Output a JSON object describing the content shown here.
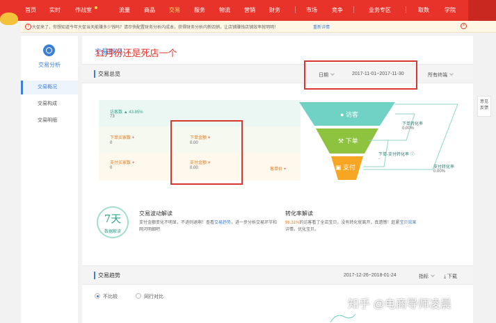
{
  "nav": {
    "items": [
      "首页",
      "实时",
      "作战室",
      "流量",
      "商品",
      "交易",
      "服务",
      "物流",
      "营销",
      "财务",
      "市场",
      "竞争",
      "业务专区",
      "取数",
      "学院"
    ]
  },
  "notice": {
    "text": "大促来了，你想知道今年大促当天能赚多少钱吗？请尽快配置财务分析内成本，获得财务分析内新四销，让店铺赚钱店铺效率就明明！",
    "link": "重新详情",
    "close": "×"
  },
  "sidebar": {
    "title": "交易分析",
    "items": [
      "交易概况",
      "交易构成",
      "交易明细"
    ]
  },
  "main": {
    "page_title": "交易概况",
    "overview": {
      "label": "交易总览",
      "date_label": "日期",
      "date_range": "2017-11-01~2017-11-30",
      "terminal": "所有终端"
    },
    "annotation": "11月份还是死店一个",
    "metrics": {
      "visitors": {
        "label": "访客数",
        "change": "▲ 43.85%",
        "value": "73"
      },
      "order_buyers": {
        "label": "下单买家数",
        "plus": "+",
        "value": "0"
      },
      "order_amount": {
        "label": "下单金额",
        "plus": "+",
        "value": "0.00"
      },
      "pay_buyers": {
        "label": "支付买家数",
        "plus": "+",
        "value": "0"
      },
      "pay_amount": {
        "label": "支付金额",
        "plus": "+",
        "value": "0.00"
      },
      "avg_price": {
        "label": "客单价",
        "plus": "+"
      }
    },
    "funnel": {
      "visit": "访客",
      "order": "下单",
      "pay": "支付",
      "order_rate_label": "下单转化率",
      "order_rate_value": "0.00%",
      "order_pay_rate_label": "下单-支付转化率 ⓘ",
      "order_pay_rate_value": "-",
      "pay_rate_label": "支付转化率",
      "pay_rate_value": "0.00%"
    },
    "explain": {
      "badge_num": "7天",
      "badge_cap": "数据解读",
      "wave_title": "交易波动解读",
      "wave_text_1": "支付金额变化不明显，不进则退啊！查看",
      "wave_link": "交易趋势",
      "wave_text_2": "，进一步分析交易环节和",
      "wave_text_3": "网河明细吧",
      "conv_title": "转化率解读",
      "conv_pct": "98.31%",
      "conv_text_1": "的访客看了全店宝贝，没有转化就离开，真遗憾！赶紧",
      "conv_link": "宝贝效果",
      "conv_text_2": "详情，优化宝贝。"
    },
    "trend": {
      "label": "交易趋势",
      "date_range": "2017-12-26~2018-01-24",
      "metric": "指标",
      "download": "下载",
      "radio_1": "不比较",
      "radio_2": "同行对比"
    }
  },
  "right_tab": {
    "line1": "意见",
    "line2": "反馈"
  },
  "watermark": "知乎 @电商导师凌晨"
}
